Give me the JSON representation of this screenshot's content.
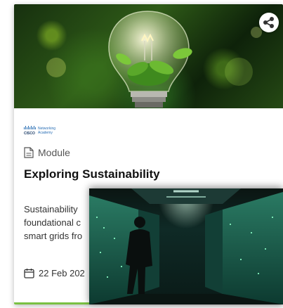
{
  "card": {
    "logo": {
      "brand_top": "Networking",
      "brand_bottom": "Academy",
      "cisco": "CISCO"
    },
    "type_label": "Module",
    "title": "Exploring Sustainability",
    "description_lines": [
      "Sustainability",
      "foundational c",
      "smart grids fro"
    ],
    "date": "22 Feb 202",
    "colors": {
      "accent_green": "#7ac143",
      "title": "#111111"
    }
  },
  "icons": {
    "share": "share-icon",
    "module": "document-icon",
    "date": "calendar-icon"
  }
}
